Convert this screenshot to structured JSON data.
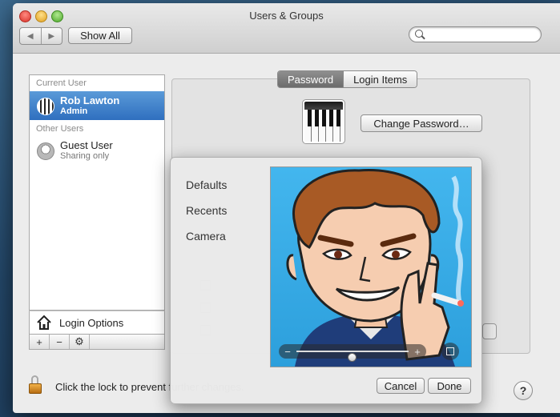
{
  "window": {
    "title": "Users & Groups"
  },
  "toolbar": {
    "back_icon": "◀",
    "forward_icon": "▶",
    "show_all_label": "Show All",
    "search_placeholder": ""
  },
  "sidebar": {
    "current_user_header": "Current User",
    "other_users_header": "Other Users",
    "users": [
      {
        "name": "Rob Lawton",
        "role": "Admin",
        "selected": true,
        "avatar": "piano"
      },
      {
        "name": "Guest User",
        "role": "Sharing only",
        "selected": false,
        "avatar": "guest"
      }
    ],
    "login_options_label": "Login Options",
    "add_icon": "+",
    "remove_icon": "−",
    "action_icon": "⚙"
  },
  "tabs": [
    "Password",
    "Login Items"
  ],
  "active_tab": "Password",
  "main": {
    "change_password_label": "Change Password…"
  },
  "picker": {
    "categories": [
      "Defaults",
      "Recents",
      "Camera"
    ],
    "zoom_minus": "−",
    "zoom_plus": "+",
    "zoom_level": 0.35,
    "cancel_label": "Cancel",
    "done_label": "Done"
  },
  "footer": {
    "lock_text": "Click the lock to prevent further changes.",
    "help_label": "?"
  },
  "colors": {
    "selection": "#3a7bd0",
    "picture_bg": "#3aaee9"
  }
}
